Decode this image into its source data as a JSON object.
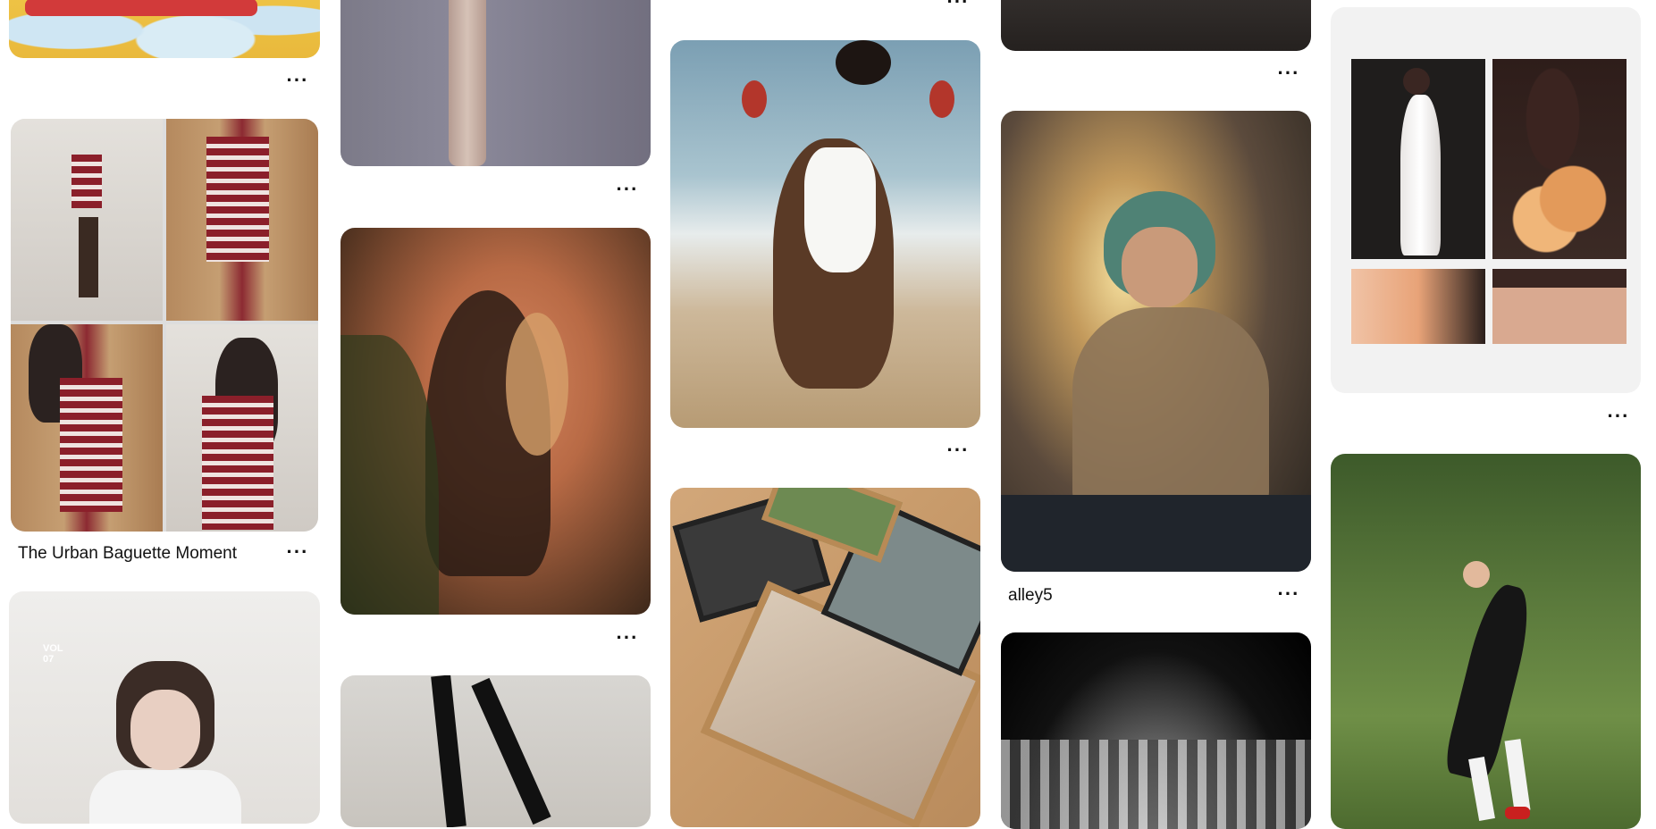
{
  "pins": {
    "baguette": {
      "title": "The Urban Baguette Moment"
    },
    "alley5": {
      "title": "alley5"
    },
    "girl_poster": {
      "vol": "VOL\n07"
    }
  },
  "more_label": "···",
  "icons": {
    "more": "more-horizontal-icon"
  }
}
